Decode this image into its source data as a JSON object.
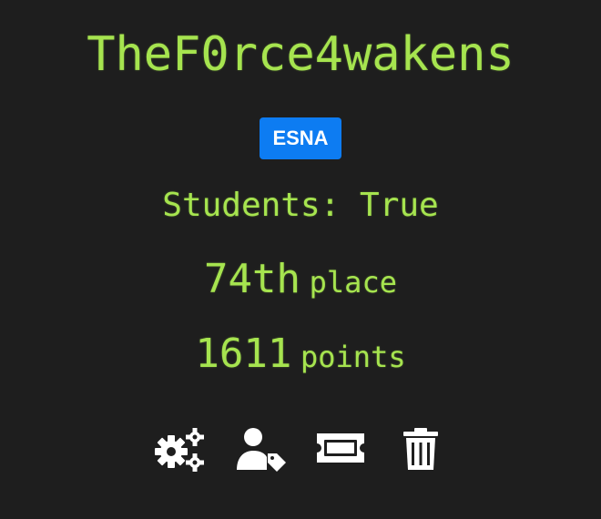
{
  "team": {
    "name": "TheF0rce4wakens",
    "badge": "ESNA",
    "students_label": "Students: True",
    "place_number": "74th",
    "place_label": "place",
    "points_number": "1611",
    "points_label": "points"
  },
  "actions": [
    {
      "icon": "gears-icon"
    },
    {
      "icon": "user-tag-icon"
    },
    {
      "icon": "ticket-icon"
    },
    {
      "icon": "trash-icon"
    }
  ],
  "colors": {
    "background": "#1e1e1e",
    "text": "#a6e44f",
    "badge": "#0d7cf2",
    "icons": "#ffffff"
  }
}
